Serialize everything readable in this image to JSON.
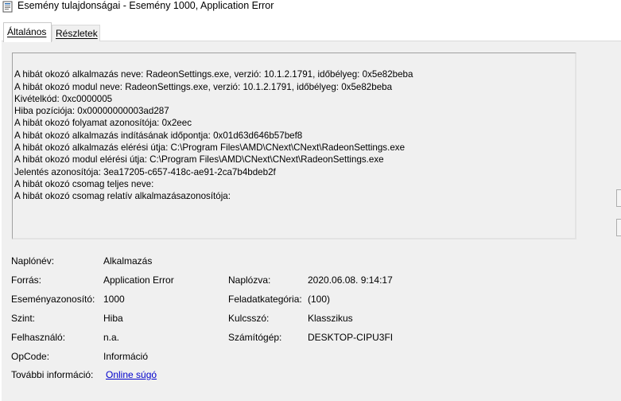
{
  "window": {
    "title": "Esemény tulajdonságai - Esemény 1000, Application Error"
  },
  "tabs": [
    {
      "label": "Általános",
      "selected": true
    },
    {
      "label": "Részletek",
      "selected": false
    }
  ],
  "message_lines": [
    "A hibát okozó alkalmazás neve: RadeonSettings.exe, verzió: 10.1.2.1791, időbélyeg: 0x5e82beba",
    "A hibát okozó modul neve: RadeonSettings.exe, verzió: 10.1.2.1791, időbélyeg: 0x5e82beba",
    "Kivételkód: 0xc0000005",
    "Hiba pozíciója: 0x00000000003ad287",
    "A hibát okozó folyamat azonosítója: 0x2eec",
    "A hibát okozó alkalmazás indításának időpontja: 0x01d63d646b57bef8",
    "A hibát okozó alkalmazás elérési útja: C:\\Program Files\\AMD\\CNext\\CNext\\RadeonSettings.exe",
    "A hibát okozó modul elérési útja: C:\\Program Files\\AMD\\CNext\\CNext\\RadeonSettings.exe",
    "Jelentés azonosítója: 3ea17205-c657-418c-ae91-2ca7b4bdeb2f",
    "A hibát okozó csomag teljes neve:",
    "A hibát okozó csomag relatív alkalmazásazonosítója:"
  ],
  "fields": {
    "log_name": {
      "label": "Naplónév:",
      "value": "Alkalmazás"
    },
    "source": {
      "label": "Forrás:",
      "value": "Application Error"
    },
    "logged": {
      "label": "Naplózva:",
      "value": "2020.06.08. 9:14:17"
    },
    "event_id": {
      "label": "Eseményazonosító:",
      "value": "1000"
    },
    "task_category": {
      "label": "Feladatkategória:",
      "value": "(100)"
    },
    "level": {
      "label": "Szint:",
      "value": "Hiba"
    },
    "keywords": {
      "label": "Kulcsszó:",
      "value": "Klasszikus"
    },
    "user": {
      "label": "Felhasználó:",
      "value": "n.a."
    },
    "computer": {
      "label": "Számítógép:",
      "value": "DESKTOP-CIPU3FI"
    },
    "opcode": {
      "label": "OpCode:",
      "value": "Információ"
    },
    "more_info": {
      "label": "További információ:",
      "value": "Online súgó"
    }
  },
  "colors": {
    "link": "#0000cc",
    "panel_bg": "#f0f0f0"
  }
}
